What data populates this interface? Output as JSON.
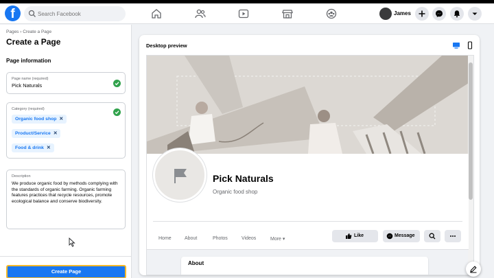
{
  "topbar": {
    "logo": "f",
    "search_placeholder": "Search Facebook",
    "nav_icons": [
      "home-icon",
      "friends-icon",
      "watch-icon",
      "marketplace-icon",
      "groups-icon"
    ],
    "user_name": "James",
    "action_icons": [
      "plus-icon",
      "messenger-icon",
      "bell-icon",
      "chevron-down-icon"
    ]
  },
  "left_panel": {
    "breadcrumb": "Pages › Create a Page",
    "title": "Create a Page",
    "section_heading": "Page information",
    "page_name": {
      "label": "Page name (required)",
      "value": "Pick Naturals"
    },
    "category": {
      "label": "Category (required)",
      "chips": [
        "Organic food shop",
        "Product/Service",
        "Food & drink"
      ]
    },
    "description": {
      "label": "Description",
      "value": "We produce organic food by methods complying with the standards of organic farming. Organic farming features practices that recycle resources, promote ecological balance and conserve biodiversity."
    },
    "create_button": "Create Page"
  },
  "preview": {
    "title": "Desktop preview",
    "device_icons": [
      "desktop-icon",
      "mobile-icon"
    ],
    "page_name": "Pick Naturals",
    "page_category": "Organic food shop",
    "tabs": [
      "Home",
      "About",
      "Photos",
      "Videos",
      "More ▾"
    ],
    "buttons": {
      "like": "Like",
      "message": "Message"
    },
    "about_heading": "About"
  },
  "colors": {
    "brand": "#1877f2",
    "check": "#31a24c",
    "focus_border": "#f7b928"
  }
}
